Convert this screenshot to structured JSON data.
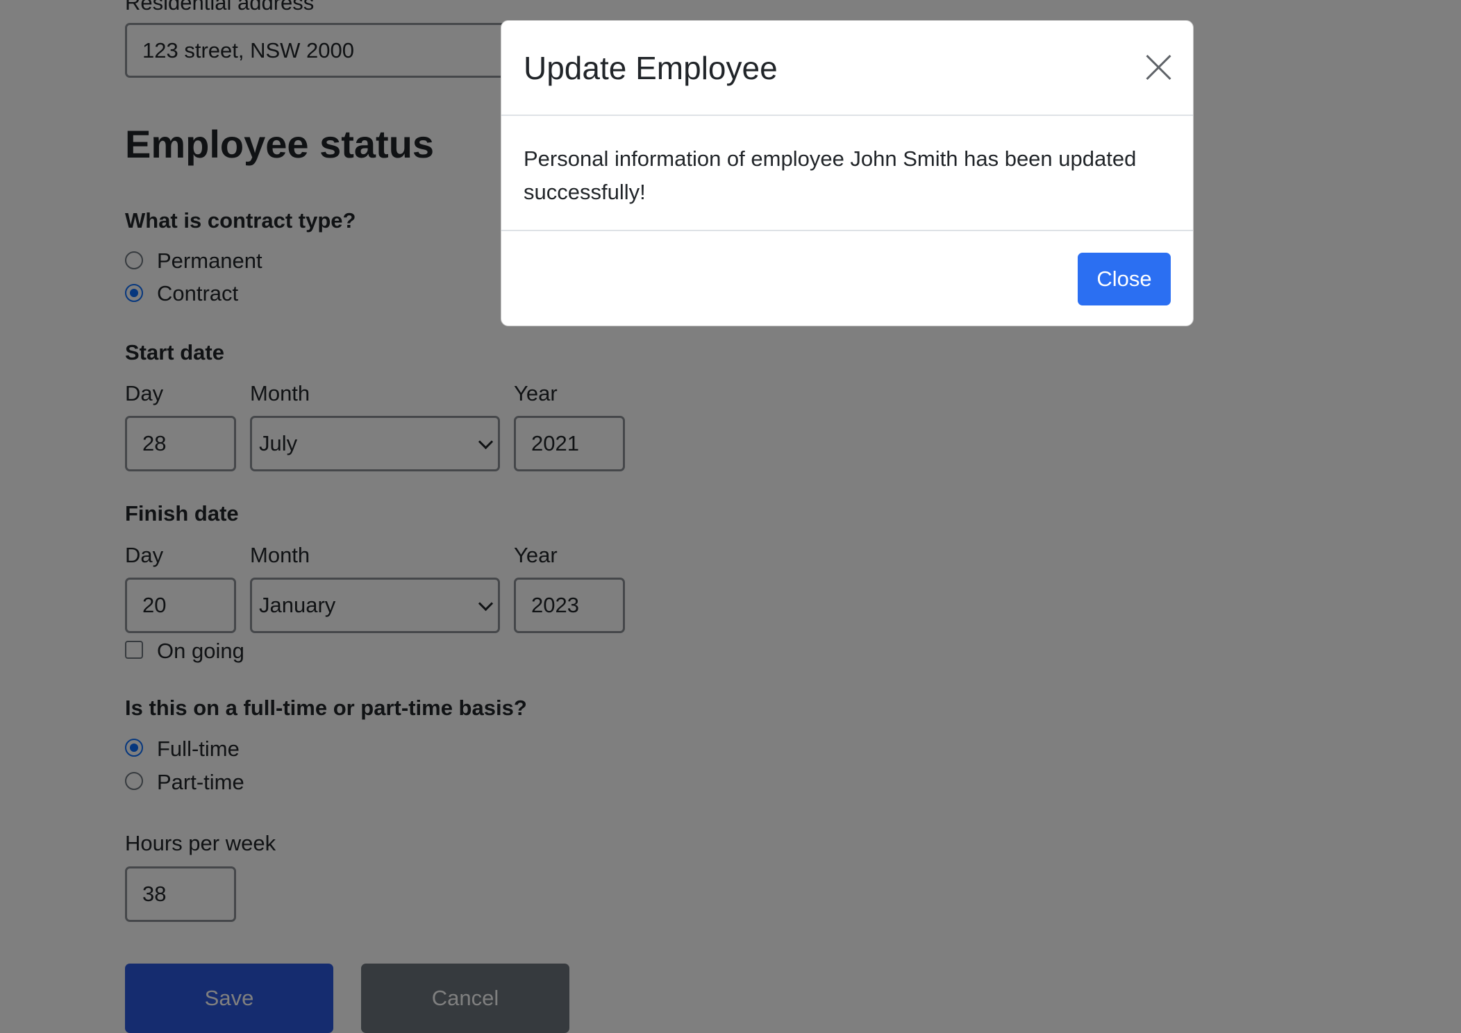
{
  "form": {
    "residential_address": {
      "label": "Residential address",
      "value": "123 street, NSW 2000"
    },
    "section_title": "Employee status",
    "contract_type": {
      "question": "What is contract type?",
      "options": [
        {
          "label": "Permanent",
          "checked": false
        },
        {
          "label": "Contract",
          "checked": true
        }
      ]
    },
    "start_date": {
      "label": "Start date",
      "day_label": "Day",
      "month_label": "Month",
      "year_label": "Year",
      "day": "28",
      "month": "July",
      "year": "2021"
    },
    "finish_date": {
      "label": "Finish date",
      "day_label": "Day",
      "month_label": "Month",
      "year_label": "Year",
      "day": "20",
      "month": "January",
      "year": "2023",
      "ongoing_label": "On going",
      "ongoing_checked": false
    },
    "basis": {
      "question": "Is this on a full-time or part-time basis?",
      "options": [
        {
          "label": "Full-time",
          "checked": true
        },
        {
          "label": "Part-time",
          "checked": false
        }
      ]
    },
    "hours": {
      "label": "Hours per week",
      "value": "38"
    },
    "save_label": "Save",
    "cancel_label": "Cancel"
  },
  "modal": {
    "title": "Update Employee",
    "message": "Personal information of employee John Smith has been updated successfully!",
    "close_button_label": "Close",
    "close_icon": "close-icon"
  },
  "colors": {
    "primary": "#2b6ff2",
    "secondary": "#6c757d",
    "backdrop": "rgba(0,0,0,0.5)"
  }
}
